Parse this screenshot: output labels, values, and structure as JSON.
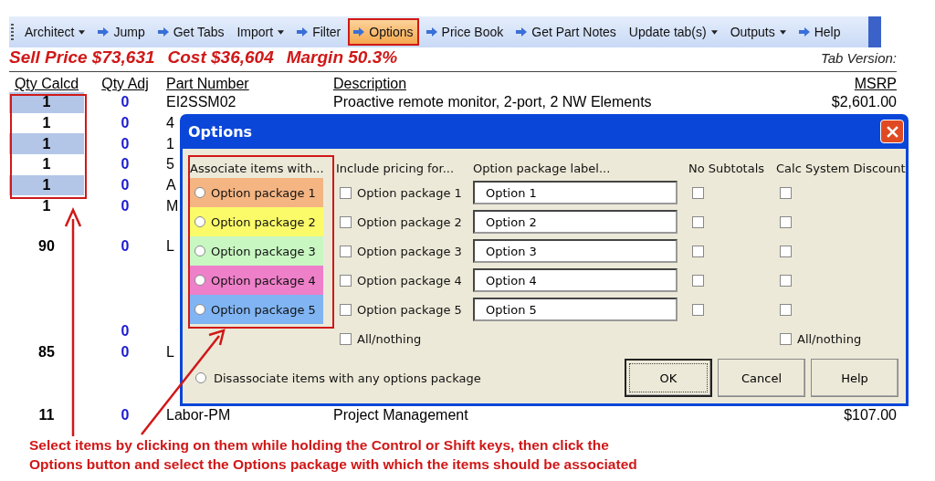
{
  "toolbar": {
    "items": [
      {
        "label": "Architect",
        "kind": "dropdown",
        "selected": false
      },
      {
        "label": "Jump",
        "kind": "arrow",
        "selected": false
      },
      {
        "label": "Get Tabs",
        "kind": "arrow",
        "selected": false
      },
      {
        "label": "Import",
        "kind": "dropdown",
        "selected": false
      },
      {
        "label": "Filter",
        "kind": "arrow",
        "selected": false
      },
      {
        "label": "Options",
        "kind": "arrow",
        "selected": true
      },
      {
        "label": "Price Book",
        "kind": "arrow",
        "selected": false
      },
      {
        "label": "Get Part Notes",
        "kind": "arrow",
        "selected": false
      },
      {
        "label": "Update tab(s)",
        "kind": "dropdown",
        "selected": false
      },
      {
        "label": "Outputs",
        "kind": "dropdown",
        "selected": false
      },
      {
        "label": "Help",
        "kind": "arrow",
        "selected": false
      }
    ]
  },
  "summary": {
    "sell_price": "Sell Price $73,631",
    "cost": "Cost $36,604",
    "margin": "Margin 50.3%",
    "tab_version": "Tab Version:"
  },
  "table": {
    "columns": [
      "Qty Calcd",
      "Qty Adj",
      "Part Number",
      "Description",
      "MSRP"
    ],
    "rows": [
      {
        "qty_calcd": "1",
        "qty_adj": "0",
        "part": "EI2SSM02",
        "description": "Proactive remote monitor, 2-port, 2 NW Elements",
        "msrp": "$2,601.00",
        "highlighted": true
      },
      {
        "qty_calcd": "1",
        "qty_adj": "0",
        "part": "4",
        "highlighted": false
      },
      {
        "qty_calcd": "1",
        "qty_adj": "0",
        "part": "1",
        "highlighted": true
      },
      {
        "qty_calcd": "1",
        "qty_adj": "0",
        "part": "5",
        "highlighted": false
      },
      {
        "qty_calcd": "1",
        "qty_adj": "0",
        "part": "A",
        "highlighted": true
      },
      {
        "qty_calcd": "1",
        "qty_adj": "0",
        "part": "M",
        "highlighted": false
      },
      {
        "qty_calcd": "90",
        "qty_adj": "0",
        "part": "L",
        "highlighted": false
      },
      {
        "qty_adj": "0"
      },
      {
        "qty_calcd": "85",
        "qty_adj": "0",
        "part": "L",
        "highlighted": false
      },
      {
        "qty_calcd": "11",
        "qty_adj": "0",
        "part": "Labor-PM",
        "description": "Project Management",
        "msrp": "$107.00",
        "highlighted": false
      }
    ]
  },
  "dialog": {
    "title": "Options",
    "headers": [
      "Associate items with...",
      "Include pricing for...",
      "Option package label...",
      "No Subtotals",
      "Calc System Discount"
    ],
    "packages": [
      {
        "label": "Option package 1",
        "color": "#f4b583",
        "selected": false,
        "include_label": "Option package 1",
        "include_checked": false,
        "field_value": "Option 1",
        "no_subtotals": false,
        "calc_discount": false
      },
      {
        "label": "Option package 2",
        "color": "#fbfb6a",
        "selected": false,
        "include_label": "Option package 2",
        "include_checked": false,
        "field_value": "Option 2",
        "no_subtotals": false,
        "calc_discount": false
      },
      {
        "label": "Option package 3",
        "color": "#c8f7c2",
        "selected": false,
        "include_label": "Option package 3",
        "include_checked": false,
        "field_value": "Option 3",
        "no_subtotals": false,
        "calc_discount": false
      },
      {
        "label": "Option package 4",
        "color": "#ee7fc9",
        "selected": false,
        "include_label": "Option package 4",
        "include_checked": false,
        "field_value": "Option 4",
        "no_subtotals": false,
        "calc_discount": false
      },
      {
        "label": "Option package 5",
        "color": "#80b4f2",
        "selected": false,
        "include_label": "Option package 5",
        "include_checked": false,
        "field_value": "Option 5",
        "no_subtotals": false,
        "calc_discount": false
      }
    ],
    "include_all": {
      "label": "All/nothing",
      "checked": false
    },
    "discount_all": {
      "label": "All/nothing",
      "checked": false
    },
    "disassociate": {
      "label": "Disassociate items with any options package",
      "selected": false
    },
    "buttons": [
      {
        "label": "OK",
        "focused": true
      },
      {
        "label": "Cancel",
        "focused": false
      },
      {
        "label": "Help",
        "focused": false
      }
    ]
  },
  "note": "Select items by clicking on them while holding the Control or Shift keys, then click the Options button and select the Options package with which the items should be associated"
}
